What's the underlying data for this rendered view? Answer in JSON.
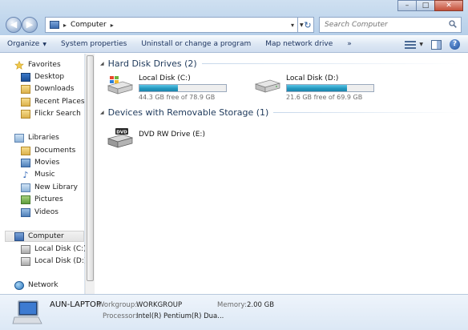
{
  "window": {
    "minimize": "–",
    "maximize": "□",
    "close": "✕"
  },
  "address": {
    "path": [
      "Computer"
    ],
    "search_placeholder": "Search Computer"
  },
  "toolbar": {
    "organize": "Organize",
    "system_properties": "System properties",
    "uninstall": "Uninstall or change a program",
    "map_drive": "Map network drive",
    "more": "»"
  },
  "nav": {
    "favorites": "Favorites",
    "desktop": "Desktop",
    "downloads": "Downloads",
    "recent_places": "Recent Places",
    "flickr_search": "Flickr Search",
    "libraries": "Libraries",
    "documents": "Documents",
    "movies": "Movies",
    "music": "Music",
    "new_library": "New Library",
    "pictures": "Pictures",
    "videos": "Videos",
    "computer": "Computer",
    "local_c": "Local Disk (C:)",
    "local_d": "Local Disk (D:)",
    "network": "Network"
  },
  "groups": {
    "hard_disks": "Hard Disk Drives (2)",
    "removable": "Devices with Removable Storage (1)"
  },
  "drives": [
    {
      "name": "Local Disk (C:)",
      "free": "44.3 GB free of 78.9 GB",
      "used_fraction": 0.44
    },
    {
      "name": "Local Disk (D:)",
      "free": "21.6 GB free of 69.9 GB",
      "used_fraction": 0.69
    },
    {
      "name": "DVD RW Drive (E:)"
    }
  ],
  "details": {
    "computer_name": "AUN-LAPTOP",
    "workgroup_label": "Workgroup:",
    "workgroup": "WORKGROUP",
    "memory_label": "Memory:",
    "memory": "2.00 GB",
    "processor_label": "Processor:",
    "processor": "Intel(R) Pentium(R) Dua..."
  },
  "colors": {
    "bar_fill": "#2598bf",
    "header_text": "#1e395b",
    "toolbar_text": "#1e3560"
  }
}
